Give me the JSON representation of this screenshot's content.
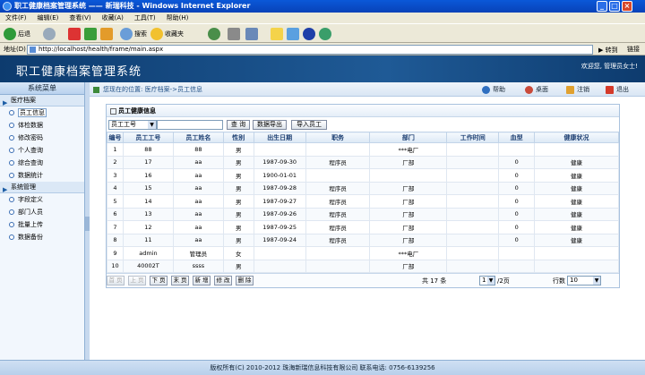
{
  "window": {
    "title": "职工健康档案管理系统 —— 新瑞科技 - Windows Internet Explorer"
  },
  "menu": [
    "文件(F)",
    "编辑(E)",
    "查看(V)",
    "收藏(A)",
    "工具(T)",
    "帮助(H)"
  ],
  "toolbar": {
    "back": "后退",
    "search": "搜索",
    "favorites": "收藏夹"
  },
  "address": {
    "label": "地址(D)",
    "url": "http://localhost/health/frame/main.aspx",
    "go": "转到",
    "links": "链接"
  },
  "banner": {
    "title": "职工健康档案管理系统",
    "welcome": "欢迎您, 管理员女士!"
  },
  "sidebar": {
    "header": "系统菜单",
    "sections": [
      {
        "label": "医疗档案",
        "items": [
          "员工信息",
          "体检数据",
          "修改密码",
          "个人查询",
          "综合查询",
          "数据统计"
        ]
      },
      {
        "label": "系统管理",
        "items": [
          "字段定义",
          "部门人员",
          "批量上传",
          "数据备份"
        ]
      }
    ]
  },
  "crumb": {
    "location": "您现在的位置: 医疗档案->员工信息",
    "help": "帮助",
    "desktop": "桌面",
    "logout": "注销",
    "exit": "退出"
  },
  "panel": {
    "title": "员工健康信息",
    "field_select": "员工工号",
    "search_btn": "查 询",
    "export_btn": "数据导出",
    "import_btn": "导入员工"
  },
  "table": {
    "headers": [
      "编号",
      "员工工号",
      "员工姓名",
      "性别",
      "出生日期",
      "职务",
      "部门",
      "工作时间",
      "血型",
      "健康状况"
    ],
    "rows": [
      [
        "1",
        "88",
        "88",
        "男",
        "",
        "",
        "***电厂",
        "",
        "",
        ""
      ],
      [
        "2",
        "17",
        "aa",
        "男",
        "1987-09-30",
        "程序员",
        "厂部",
        "",
        "0",
        "健康"
      ],
      [
        "3",
        "16",
        "aa",
        "男",
        "1900-01-01",
        "",
        "",
        "",
        "0",
        "健康"
      ],
      [
        "4",
        "15",
        "aa",
        "男",
        "1987-09-28",
        "程序员",
        "厂部",
        "",
        "0",
        "健康"
      ],
      [
        "5",
        "14",
        "aa",
        "男",
        "1987-09-27",
        "程序员",
        "厂部",
        "",
        "0",
        "健康"
      ],
      [
        "6",
        "13",
        "aa",
        "男",
        "1987-09-26",
        "程序员",
        "厂部",
        "",
        "0",
        "健康"
      ],
      [
        "7",
        "12",
        "aa",
        "男",
        "1987-09-25",
        "程序员",
        "厂部",
        "",
        "0",
        "健康"
      ],
      [
        "8",
        "11",
        "aa",
        "男",
        "1987-09-24",
        "程序员",
        "厂部",
        "",
        "0",
        "健康"
      ],
      [
        "9",
        "admin",
        "管理员",
        "女",
        "",
        "",
        "***电厂",
        "",
        "",
        ""
      ],
      [
        "10",
        "40002T",
        "ssss",
        "男",
        "",
        "",
        "厂部",
        "",
        "",
        ""
      ]
    ]
  },
  "pager": {
    "first": "首 页",
    "prev": "上 页",
    "next": "下 页",
    "last": "末 页",
    "add": "新 增",
    "edit": "修 改",
    "del": "删 除",
    "total": "共 17 条",
    "page": "1",
    "pages": "/2页",
    "rows_label": "行数",
    "rows_val": "10"
  },
  "footer": "版权所有(C) 2010-2012 珠海新瑞信息科技有限公司 联系电话: 0756-6139256"
}
